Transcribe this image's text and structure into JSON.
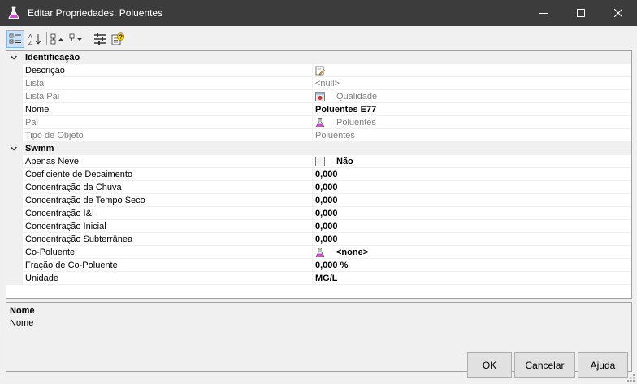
{
  "window": {
    "title": "Editar Propriedades: Poluentes",
    "icon": "flask-icon",
    "controls": [
      "minimize",
      "maximize",
      "close"
    ]
  },
  "toolbar": {
    "buttons": [
      "categorized-view",
      "alphabetical-view",
      "expand-all",
      "collapse-all",
      "property-pages",
      "help"
    ]
  },
  "grid": {
    "categories": [
      {
        "label": "Identificação",
        "rows": [
          {
            "name": "Descrição",
            "value": "",
            "icon": "edit-icon",
            "readonly": false,
            "bold": false
          },
          {
            "name": "Lista",
            "value": "<null>",
            "readonly": true,
            "bold": false
          },
          {
            "name": "Lista Pai",
            "value": "Qualidade",
            "icon": "list-icon",
            "readonly": true,
            "bold": false
          },
          {
            "name": "Nome",
            "value": "Poluentes E77",
            "readonly": false,
            "bold": true
          },
          {
            "name": "Pai",
            "value": "Poluentes",
            "icon": "flask-icon",
            "readonly": true,
            "bold": false
          },
          {
            "name": "Tipo de Objeto",
            "value": "Poluentes",
            "readonly": true,
            "bold": false
          }
        ]
      },
      {
        "label": "Swmm",
        "rows": [
          {
            "name": "Apenas Neve",
            "value": "Não",
            "checkbox": true,
            "readonly": false,
            "bold": true
          },
          {
            "name": "Coeficiente de Decaimento",
            "value": "0,000",
            "readonly": false,
            "bold": true
          },
          {
            "name": "Concentração da Chuva",
            "value": "0,000",
            "readonly": false,
            "bold": true
          },
          {
            "name": "Concentração de Tempo Seco",
            "value": "0,000",
            "readonly": false,
            "bold": true
          },
          {
            "name": "Concentração I&I",
            "value": "0,000",
            "readonly": false,
            "bold": true
          },
          {
            "name": "Concentração Inicial",
            "value": "0,000",
            "readonly": false,
            "bold": true
          },
          {
            "name": "Concentração Subterrânea",
            "value": "0,000",
            "readonly": false,
            "bold": true
          },
          {
            "name": "Co-Poluente",
            "value": "<none>",
            "icon": "flask-icon",
            "readonly": false,
            "bold": true
          },
          {
            "name": "Fração de Co-Poluente",
            "value": "0,000 %",
            "readonly": false,
            "bold": true
          },
          {
            "name": "Unidade",
            "value": "MG/L",
            "readonly": false,
            "bold": true
          }
        ]
      }
    ]
  },
  "description": {
    "title": "Nome",
    "text": "Nome"
  },
  "buttons": {
    "ok": "OK",
    "cancel": "Cancelar",
    "help": "Ajuda"
  }
}
